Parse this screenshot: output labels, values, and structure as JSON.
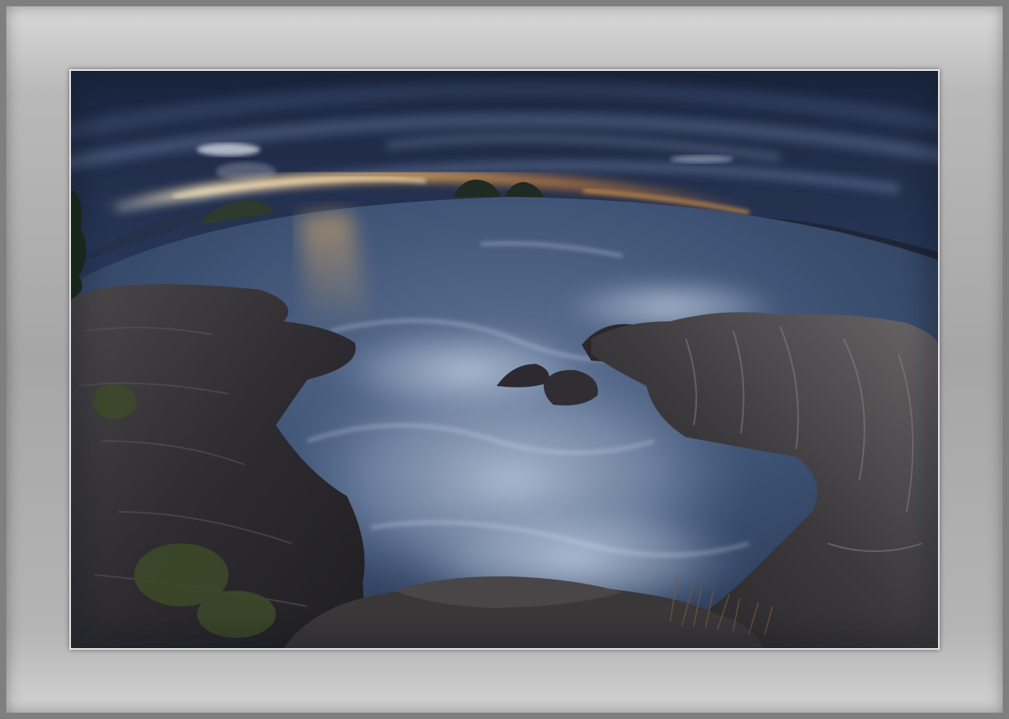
{
  "image": {
    "kind": "fisheye seascape photograph",
    "colors": {
      "frame": "#7f7f7f",
      "mat": "#b0b0b0",
      "sky_top": "#1d2a44",
      "sky_horizon": "#4a5f86",
      "sunset_glow": "#f0b25a",
      "sea": "#3a4f70",
      "foam": "#c7d3e6",
      "rock": "#3b3a3d"
    }
  }
}
